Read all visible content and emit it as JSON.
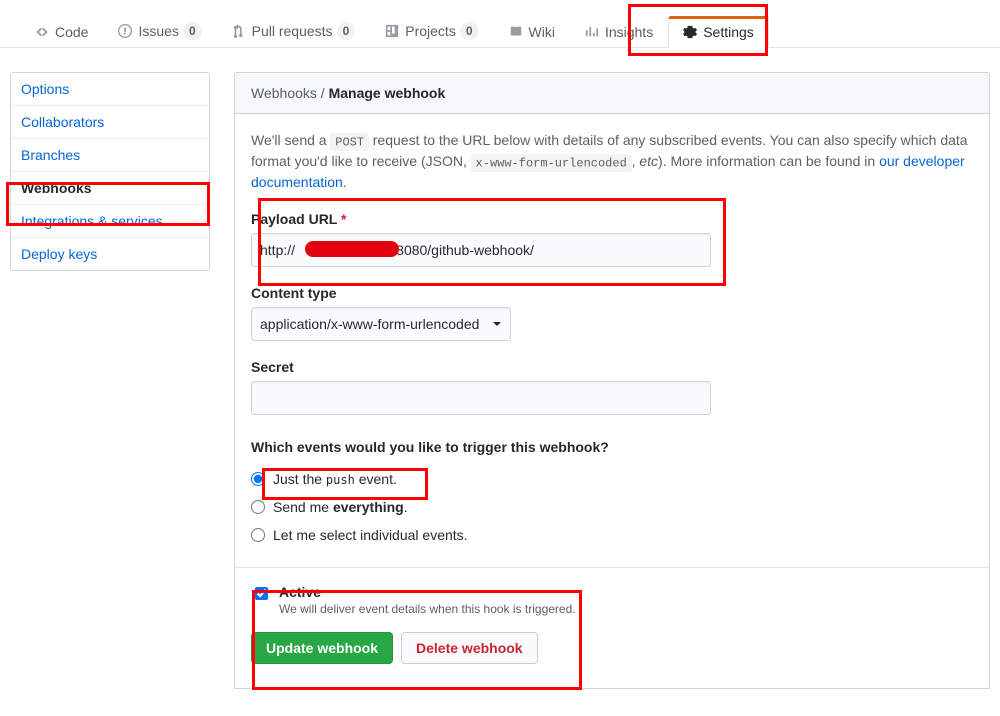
{
  "nav": {
    "code": "Code",
    "issues": "Issues",
    "issues_count": "0",
    "pulls": "Pull requests",
    "pulls_count": "0",
    "projects": "Projects",
    "projects_count": "0",
    "wiki": "Wiki",
    "insights": "Insights",
    "settings": "Settings"
  },
  "sidebar": {
    "options": "Options",
    "collaborators": "Collaborators",
    "branches": "Branches",
    "webhooks": "Webhooks",
    "integrations": "Integrations & services",
    "deploy_keys": "Deploy keys"
  },
  "header": {
    "crumb": "Webhooks",
    "current": "Manage webhook"
  },
  "intro": {
    "pre": "We'll send a ",
    "post_code": "POST",
    "mid": " request to the URL below with details of any subscribed events. You can also specify which data format you'd like to receive (JSON, ",
    "enc_code": "x-www-form-urlencoded",
    "after_enc": ", ",
    "etc": "etc",
    "after_etc": "). More information can be found in ",
    "link": "our developer documentation",
    "period": "."
  },
  "form": {
    "payload_label": "Payload URL",
    "payload_value": "http://                         :8080/github-webhook/",
    "content_type_label": "Content type",
    "content_type_value": "application/x-www-form-urlencoded",
    "secret_label": "Secret",
    "secret_value": "",
    "events_heading": "Which events would you like to trigger this webhook?",
    "event_push_pre": "Just the ",
    "event_push_code": "push",
    "event_push_post": " event.",
    "event_everything_pre": "Send me ",
    "event_everything_strong": "everything",
    "event_everything_post": ".",
    "event_individual": "Let me select individual events.",
    "active_label": "Active",
    "active_note": "We will deliver event details when this hook is triggered.",
    "update_btn": "Update webhook",
    "delete_btn": "Delete webhook"
  }
}
